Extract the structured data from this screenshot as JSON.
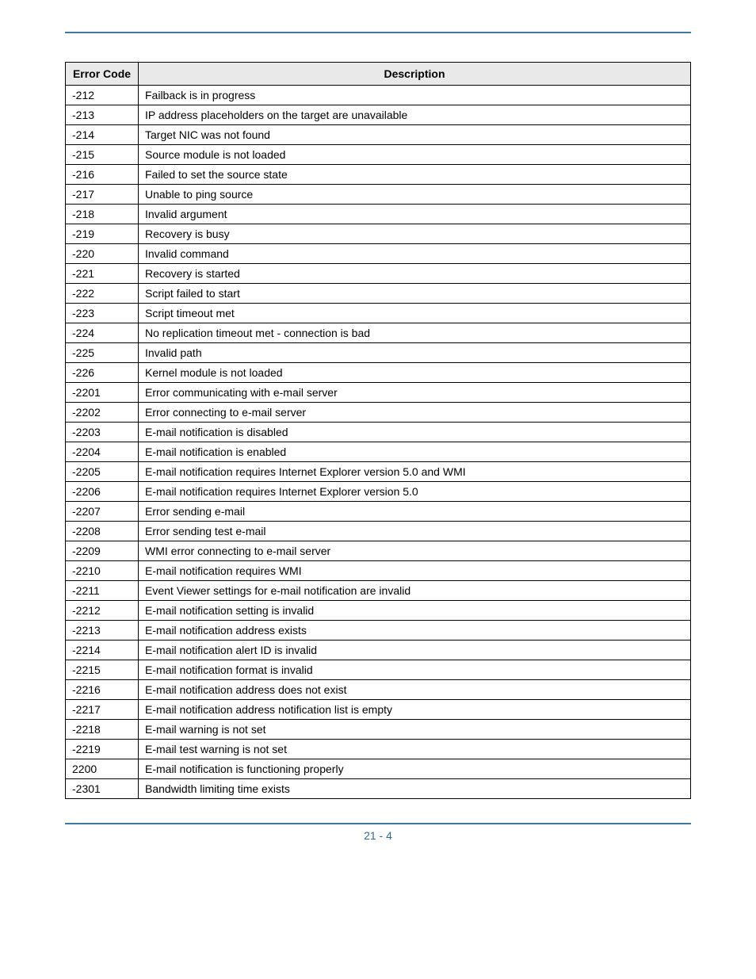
{
  "table": {
    "headers": [
      "Error Code",
      "Description"
    ],
    "rows": [
      {
        "code": "-212",
        "desc": "Failback is in progress"
      },
      {
        "code": "-213",
        "desc": "IP address placeholders on the target are unavailable"
      },
      {
        "code": "-214",
        "desc": "Target NIC was not found"
      },
      {
        "code": "-215",
        "desc": "Source module is not loaded"
      },
      {
        "code": "-216",
        "desc": "Failed to set the source state"
      },
      {
        "code": "-217",
        "desc": "Unable to ping source"
      },
      {
        "code": "-218",
        "desc": "Invalid argument"
      },
      {
        "code": "-219",
        "desc": "Recovery is busy"
      },
      {
        "code": "-220",
        "desc": "Invalid command"
      },
      {
        "code": "-221",
        "desc": "Recovery is started"
      },
      {
        "code": "-222",
        "desc": "Script failed to start"
      },
      {
        "code": "-223",
        "desc": "Script timeout met"
      },
      {
        "code": "-224",
        "desc": "No replication timeout met - connection is bad"
      },
      {
        "code": "-225",
        "desc": "Invalid path"
      },
      {
        "code": "-226",
        "desc": "Kernel module is not loaded"
      },
      {
        "code": "-2201",
        "desc": "Error communicating with e-mail server"
      },
      {
        "code": "-2202",
        "desc": "Error connecting to e-mail server"
      },
      {
        "code": "-2203",
        "desc": "E-mail notification is disabled"
      },
      {
        "code": "-2204",
        "desc": "E-mail notification is enabled"
      },
      {
        "code": "-2205",
        "desc": "E-mail notification requires Internet Explorer version 5.0 and WMI"
      },
      {
        "code": "-2206",
        "desc": "E-mail notification requires Internet Explorer version 5.0"
      },
      {
        "code": "-2207",
        "desc": "Error sending e-mail"
      },
      {
        "code": "-2208",
        "desc": "Error sending test e-mail"
      },
      {
        "code": "-2209",
        "desc": "WMI error connecting to e-mail server"
      },
      {
        "code": "-2210",
        "desc": "E-mail notification requires WMI"
      },
      {
        "code": "-2211",
        "desc": "Event Viewer settings for e-mail notification are invalid"
      },
      {
        "code": "-2212",
        "desc": "E-mail notification setting is invalid"
      },
      {
        "code": "-2213",
        "desc": "E-mail notification address exists"
      },
      {
        "code": "-2214",
        "desc": "E-mail notification alert ID is invalid"
      },
      {
        "code": "-2215",
        "desc": "E-mail notification format is invalid"
      },
      {
        "code": "-2216",
        "desc": "E-mail notification address does not exist"
      },
      {
        "code": "-2217",
        "desc": "E-mail notification address notification list is empty"
      },
      {
        "code": "-2218",
        "desc": "E-mail warning is not set"
      },
      {
        "code": "-2219",
        "desc": "E-mail test warning is not set"
      },
      {
        "code": "2200",
        "desc": "E-mail notification is functioning properly"
      },
      {
        "code": "-2301",
        "desc": "Bandwidth limiting time exists"
      }
    ]
  },
  "page_number": "21 - 4"
}
